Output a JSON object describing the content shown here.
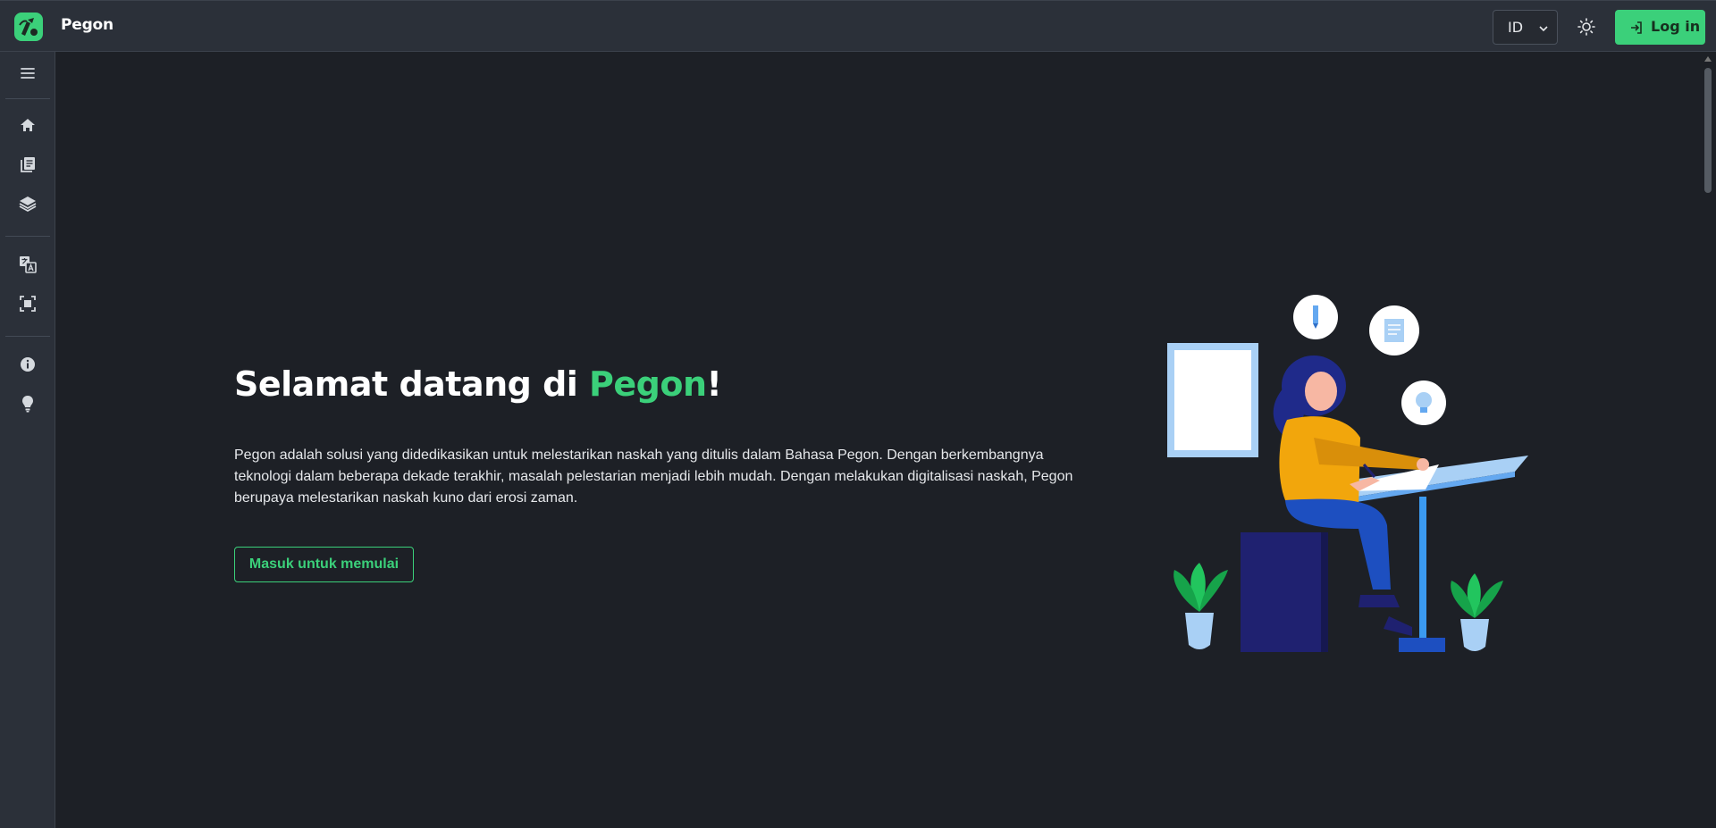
{
  "header": {
    "brand": "Pegon",
    "language": "ID",
    "login_label": "Log in"
  },
  "sidebar": {
    "items": [
      {
        "icon": "menu-icon"
      },
      {
        "icon": "home-icon"
      },
      {
        "icon": "library-icon"
      },
      {
        "icon": "layers-icon"
      },
      {
        "icon": "translate-icon"
      },
      {
        "icon": "scan-icon"
      },
      {
        "icon": "info-icon"
      },
      {
        "icon": "lightbulb-icon"
      }
    ]
  },
  "hero": {
    "title_prefix": "Selamat datang di ",
    "title_accent": "Pegon",
    "title_suffix": "!",
    "description": "Pegon adalah solusi yang didedikasikan untuk melestarikan naskah yang ditulis dalam Bahasa Pegon. Dengan berkembangnya teknologi dalam beberapa dekade terakhir, masalah pelestarian menjadi lebih mudah. Dengan melakukan digitalisasi naskah, Pegon berupaya melestarikan naskah kuno dari erosi zaman.",
    "cta_label": "Masuk untuk memulai"
  },
  "colors": {
    "accent": "#3bd07a",
    "background": "#1d2026",
    "header": "#2b3039"
  }
}
